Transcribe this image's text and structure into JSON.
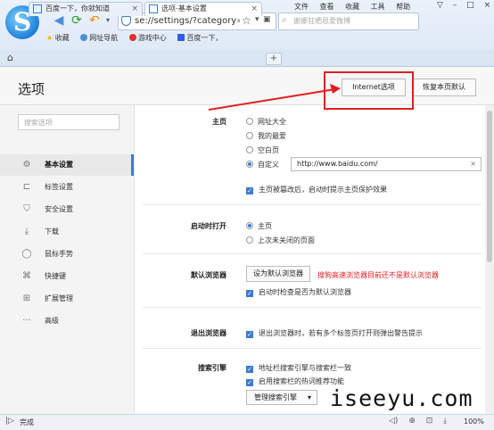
{
  "browser": {
    "menu": [
      "文件",
      "查看",
      "收藏",
      "工具",
      "帮助"
    ],
    "window_controls": [
      "▽",
      "–",
      "□",
      "×"
    ],
    "address": "se://settings/?category=gen",
    "search_placeholder": "谢娜狂晒恩爱微博",
    "bookmarks": [
      {
        "label": "收藏",
        "icon": "star-icon"
      },
      {
        "label": "网址导航",
        "icon": "globe-icon"
      },
      {
        "label": "游戏中心",
        "icon": "game-icon"
      },
      {
        "label": "百度一下，",
        "icon": "baidu-icon"
      }
    ],
    "tabs": [
      {
        "label": "百度一下，你就知道",
        "active": false
      },
      {
        "label": "选项-基本设置",
        "active": true
      }
    ],
    "new_tab": "+"
  },
  "page": {
    "title": "选项",
    "internet_options": "Internet选项",
    "restore_defaults": "恢复本页默认"
  },
  "sidebar": {
    "search_placeholder": "搜索选项",
    "items": [
      {
        "label": "基本设置",
        "icon": "gear-icon",
        "active": true
      },
      {
        "label": "标签设置",
        "icon": "tab-icon",
        "active": false
      },
      {
        "label": "安全设置",
        "icon": "shield-icon",
        "active": false
      },
      {
        "label": "下载",
        "icon": "download-icon",
        "active": false
      },
      {
        "label": "鼠标手势",
        "icon": "mouse-icon",
        "active": false
      },
      {
        "label": "快捷键",
        "icon": "shortcut-icon",
        "active": false
      },
      {
        "label": "扩展管理",
        "icon": "extension-icon",
        "active": false
      },
      {
        "label": "高级",
        "icon": "more-icon",
        "active": false
      }
    ]
  },
  "settings": {
    "homepage": {
      "label": "主页",
      "options": [
        "网址大全",
        "我的最爱",
        "空白页",
        "自定义"
      ],
      "selected": "自定义",
      "url": "http://www.baidu.com/",
      "protect": "主页被篡改后，启动时提示主页保护效果"
    },
    "startup": {
      "label": "启动时打开",
      "options": [
        "主页",
        "上次未关闭的页面"
      ],
      "selected": "主页"
    },
    "default_browser": {
      "label": "默认浏览器",
      "button": "设为默认浏览器",
      "warning": "搜狗高速浏览器目前还不是默认浏览器",
      "check": "启动时检查是否为默认浏览器"
    },
    "exit": {
      "label": "退出浏览器",
      "check": "退出浏览器时，若有多个标签页打开则弹出警告提示"
    },
    "search_engine": {
      "label": "搜索引擎",
      "checks": [
        "地址栏搜索引擎与搜索栏一致",
        "启用搜索栏的热词推荐功能"
      ],
      "manage": "管理搜索引擎"
    }
  },
  "status": {
    "text": "完成",
    "zoom": "100%"
  },
  "watermark": "iseeyu.com"
}
